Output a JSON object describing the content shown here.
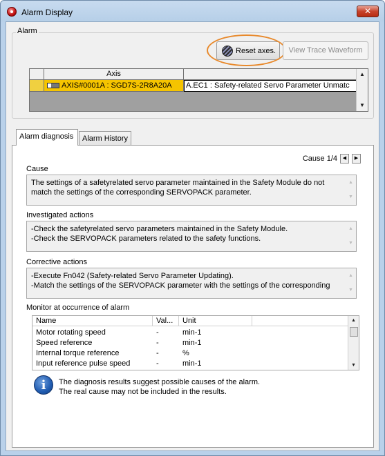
{
  "window": {
    "title": "Alarm Display",
    "close_glyph": "✕"
  },
  "alarm_group": {
    "label": "Alarm",
    "reset_button": "Reset axes.",
    "trace_button": "View Trace Waveform",
    "grid_header": "Axis",
    "rows": [
      {
        "axis": "AXIS#0001A : SGD7S-2R8A20A",
        "alarm": "A.EC1 : Safety-related Servo Parameter Unmatc"
      }
    ]
  },
  "tabs": [
    {
      "label": "Alarm diagnosis",
      "active": true
    },
    {
      "label": "Alarm History",
      "active": false
    }
  ],
  "diagnosis": {
    "cause_counter": "Cause 1/4",
    "cause": {
      "label": "Cause",
      "lines": [
        "The settings of a safetyrelated servo parameter maintained in the Safety Module do not",
        "match the settings of the corresponding SERVOPACK parameter."
      ]
    },
    "investigated": {
      "label": "Investigated actions",
      "lines": [
        "-Check the safetyrelated servo parameters maintained in the Safety Module.",
        "-Check the SERVOPACK parameters related to the safety functions."
      ]
    },
    "corrective": {
      "label": "Corrective actions",
      "lines": [
        "-Execute Fn042 (Safety-related Servo Parameter Updating).",
        "-Match the settings of the SERVOPACK parameter with the settings of the corresponding"
      ]
    },
    "monitor": {
      "label": "Monitor at occurrence of alarm",
      "columns": [
        "Name",
        "Val...",
        "Unit"
      ],
      "rows": [
        {
          "name": "Motor rotating speed",
          "value": "-",
          "unit": "min-1"
        },
        {
          "name": "Speed reference",
          "value": "-",
          "unit": "min-1"
        },
        {
          "name": "Internal torque reference",
          "value": "-",
          "unit": "%"
        },
        {
          "name": "Input reference pulse speed",
          "value": "-",
          "unit": "min-1"
        }
      ]
    },
    "note": {
      "icon": "info-icon",
      "line1": "The diagnosis results suggest possible causes of the alarm.",
      "line2": "The real cause may not be included in the results."
    }
  }
}
